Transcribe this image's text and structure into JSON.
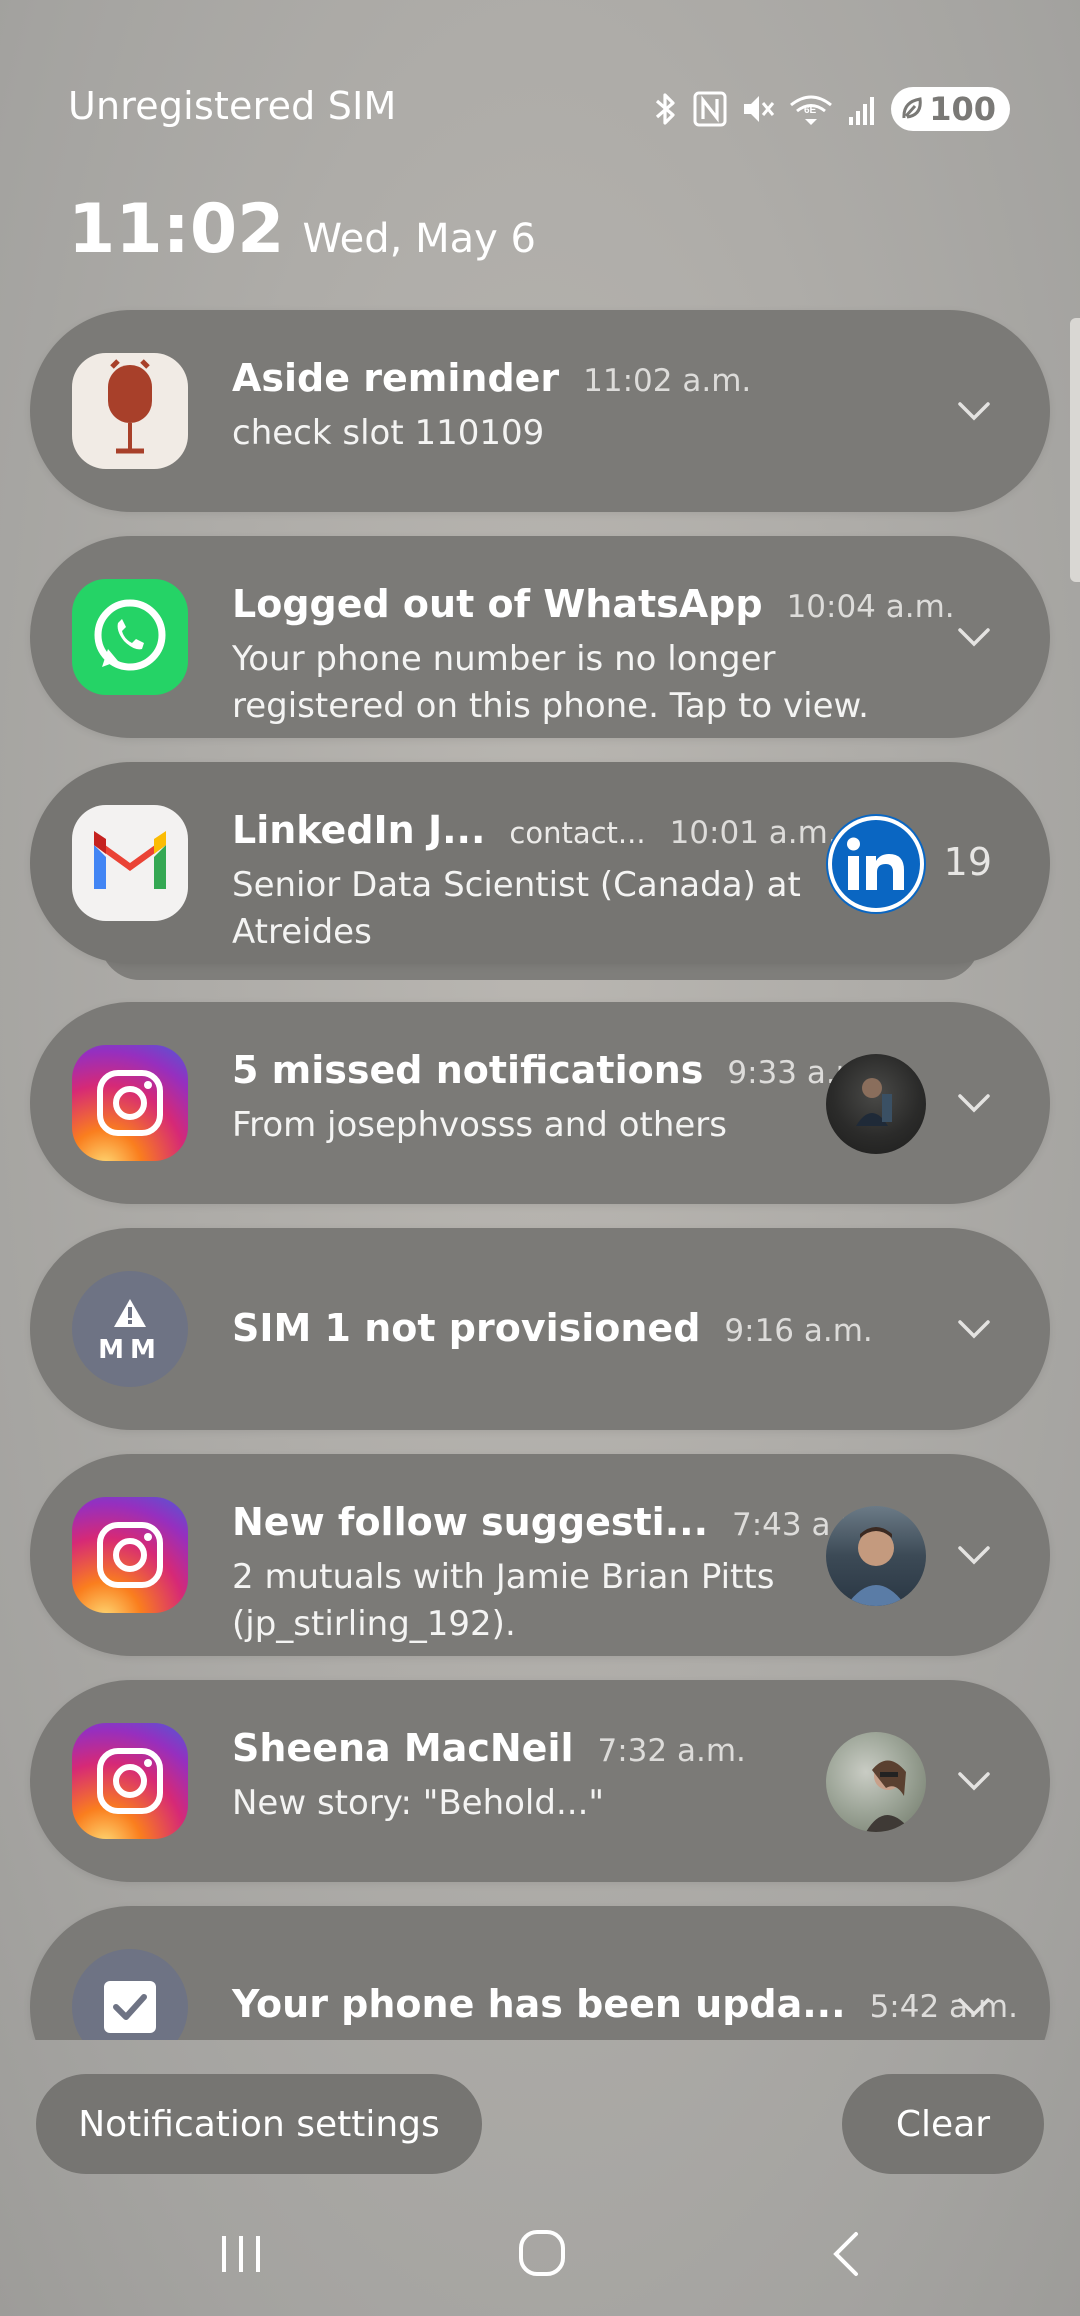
{
  "status_bar": {
    "carrier": "Unregistered SIM",
    "battery": "100",
    "icons": [
      "bluetooth-icon",
      "nfc-icon",
      "mute-icon",
      "wifi-6e-icon",
      "signal-icon",
      "battery-icon"
    ]
  },
  "header": {
    "time": "11:02",
    "date": "Wed, May 6"
  },
  "notifications": [
    {
      "app": "aside",
      "title": "Aside reminder",
      "time": "11:02 a.m.",
      "body": "check slot 110109"
    },
    {
      "app": "whatsapp",
      "title": "Logged out of WhatsApp",
      "time": "10:04 a.m.",
      "body": "Your phone number is no longer registered on this phone. Tap to view."
    },
    {
      "app": "gmail",
      "title": "LinkedIn J...",
      "subtitle": "contact...",
      "time": "10:01 a.m.",
      "body": "Senior Data Scientist (Canada) at Atreides",
      "count": "19"
    },
    {
      "app": "instagram",
      "title": "5 missed notifications",
      "time": "9:33 a.m.",
      "body": "From josephvosss and others"
    },
    {
      "app": "sim",
      "title": "SIM 1 not provisioned",
      "time": "9:16 a.m.",
      "icon_text": "MM"
    },
    {
      "app": "instagram",
      "title": "New follow suggesti...",
      "time": "7:43 a.m.",
      "body": "2 mutuals with Jamie Brian Pitts (jp_stirling_192)."
    },
    {
      "app": "instagram",
      "title": "Sheena MacNeil",
      "time": "7:32 a.m.",
      "body": "New story: \"Behold...\""
    },
    {
      "app": "software-update",
      "title": "Your phone has been upda...",
      "time": "5:42 a.m."
    }
  ],
  "actions": {
    "settings_label": "Notification settings",
    "clear_label": "Clear"
  },
  "colors": {
    "instagram_gradient": [
      "#feda75",
      "#fa7e1e",
      "#d62976",
      "#962fbf",
      "#4f5bd5"
    ],
    "whatsapp": "#25d366",
    "linkedin": "#0a66c2",
    "aside": "#a8402a"
  }
}
